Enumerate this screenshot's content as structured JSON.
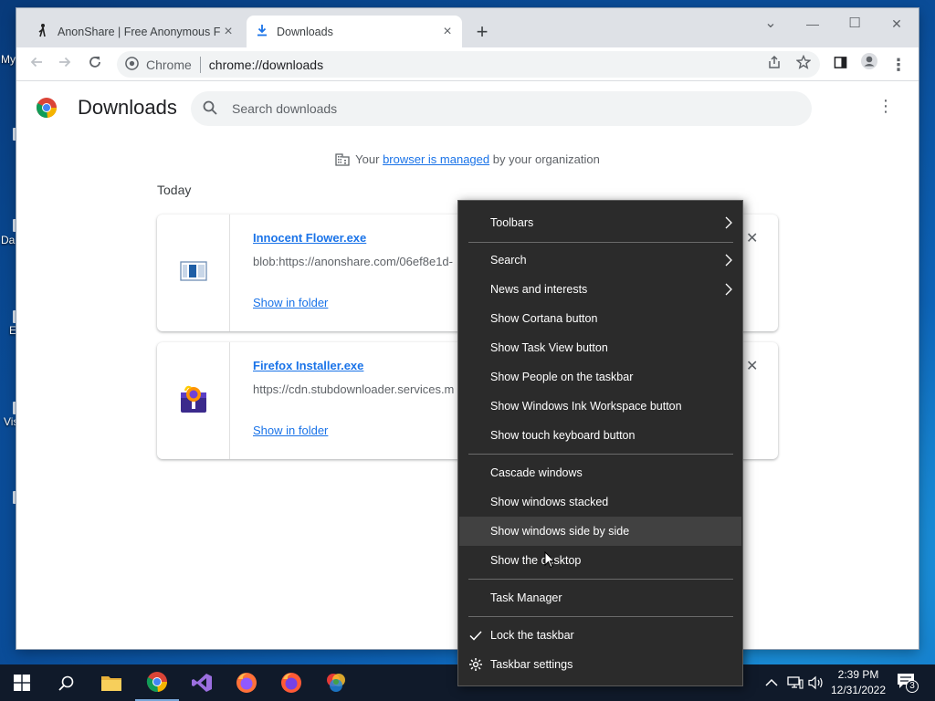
{
  "desktop": {
    "labels": [
      "My",
      "Da",
      "E",
      "Vis"
    ]
  },
  "browser": {
    "tabs": [
      {
        "title": "AnonShare | Free Anonymous File Sharing",
        "close": "×"
      },
      {
        "title": "Downloads",
        "close": "×"
      }
    ],
    "new_tab": "+",
    "window_controls": {
      "search_tabs": "⌄",
      "minimize": "—",
      "maximize": "☐",
      "close": "✕"
    },
    "omnibox": {
      "site_label": "Chrome",
      "url": "chrome://downloads"
    }
  },
  "downloads_page": {
    "title": "Downloads",
    "search_placeholder": "Search downloads",
    "managed_prefix": "Your ",
    "managed_link": "browser is managed",
    "managed_suffix": " by your organization",
    "date_header": "Today",
    "items": [
      {
        "name": "Innocent Flower.exe",
        "url": "blob:https://anonshare.com/06ef8e1d-",
        "action": "Show in folder"
      },
      {
        "name": "Firefox Installer.exe",
        "url": "https://cdn.stubdownloader.services.m",
        "action": "Show in folder"
      }
    ]
  },
  "context_menu": {
    "items": [
      {
        "label": "Toolbars",
        "submenu": true
      },
      {
        "label": "Search",
        "submenu": true
      },
      {
        "label": "News and interests",
        "submenu": true
      },
      {
        "label": "Show Cortana button"
      },
      {
        "label": "Show Task View button"
      },
      {
        "label": "Show People on the taskbar"
      },
      {
        "label": "Show Windows Ink Workspace button"
      },
      {
        "label": "Show touch keyboard button"
      },
      {
        "label": "Cascade windows"
      },
      {
        "label": "Show windows stacked"
      },
      {
        "label": "Show windows side by side",
        "highlighted": true
      },
      {
        "label": "Show the desktop"
      },
      {
        "label": "Task Manager"
      },
      {
        "label": "Lock the taskbar",
        "checked": true
      },
      {
        "label": "Taskbar settings",
        "icon": "gear-icon"
      }
    ]
  },
  "taskbar": {
    "time": "2:39 PM",
    "date": "12/31/2022",
    "notification_count": "3",
    "apps": [
      "start-icon",
      "search-icon",
      "file-explorer-icon",
      "chrome-icon",
      "visual-studio-icon",
      "firefox-icon",
      "firefox-icon",
      "paint-icon"
    ]
  },
  "colors": {
    "link": "#1a73e8",
    "menu_bg": "#2b2b2b",
    "menu_hover": "#414141",
    "taskbar_bg": "#101a2a"
  }
}
